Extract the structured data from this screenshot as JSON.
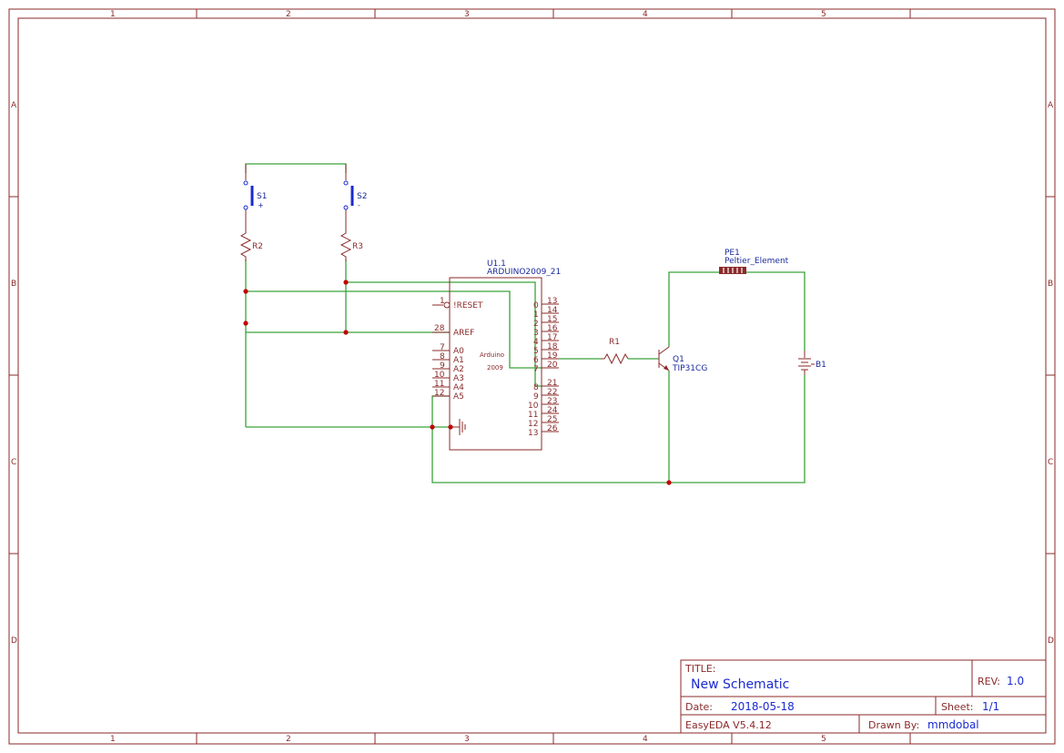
{
  "frame": {
    "columns": [
      "1",
      "2",
      "3",
      "4",
      "5"
    ],
    "rows": [
      "A",
      "B",
      "C",
      "D"
    ]
  },
  "components": {
    "s1": {
      "ref": "S1",
      "pol": "+"
    },
    "s2": {
      "ref": "S2",
      "pol": "-"
    },
    "r1": {
      "ref": "R1"
    },
    "r2": {
      "ref": "R2"
    },
    "r3": {
      "ref": "R3"
    },
    "u1": {
      "ref": "U1.1",
      "value": "ARDUINO2009_21",
      "body_text_1": "Arduino",
      "body_text_2": "2009",
      "left_pins": [
        {
          "num": "1",
          "name": "!RESET"
        },
        {
          "num": "28",
          "name": "AREF"
        },
        {
          "num": "7",
          "name": "A0"
        },
        {
          "num": "8",
          "name": "A1"
        },
        {
          "num": "9",
          "name": "A2"
        },
        {
          "num": "10",
          "name": "A3"
        },
        {
          "num": "11",
          "name": "A4"
        },
        {
          "num": "12",
          "name": "A5"
        }
      ],
      "right_pins_top": [
        {
          "name": "0",
          "num": "13"
        },
        {
          "name": "1",
          "num": "14"
        },
        {
          "name": "2",
          "num": "15"
        },
        {
          "name": "3",
          "num": "16"
        },
        {
          "name": "4",
          "num": "17"
        },
        {
          "name": "5",
          "num": "18"
        },
        {
          "name": "6",
          "num": "19"
        },
        {
          "name": "7",
          "num": "20"
        }
      ],
      "right_pins_bottom": [
        {
          "name": "8",
          "num": "21"
        },
        {
          "name": "9",
          "num": "22"
        },
        {
          "name": "10",
          "num": "23"
        },
        {
          "name": "11",
          "num": "24"
        },
        {
          "name": "12",
          "num": "25"
        },
        {
          "name": "13",
          "num": "26"
        }
      ]
    },
    "q1": {
      "ref": "Q1",
      "value": "TIP31CG"
    },
    "pe1": {
      "ref": "PE1",
      "value": "Peltier_Element"
    },
    "b1": {
      "ref": "B1"
    }
  },
  "title_block": {
    "title_label": "TITLE:",
    "title_value": "New Schematic",
    "rev_label": "REV:",
    "rev_value": "1.0",
    "date_label": "Date:",
    "date_value": "2018-05-18",
    "sheet_label": "Sheet:",
    "sheet_value": "1/1",
    "tool": "EasyEDA V5.4.12",
    "drawn_label": "Drawn By:",
    "drawn_value": "mmdobal"
  }
}
